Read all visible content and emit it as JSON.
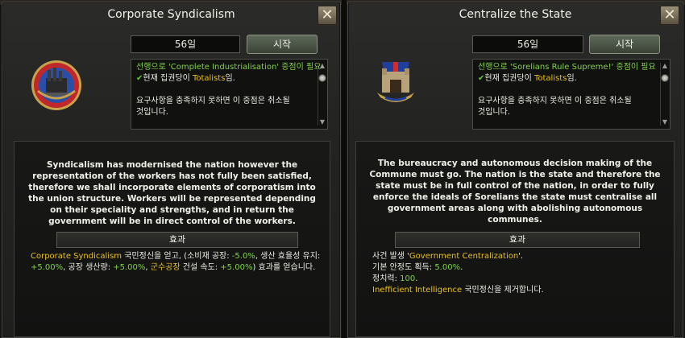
{
  "left": {
    "title": "Corporate Syndicalism",
    "days": "56일",
    "start": "시작",
    "emblem_icon": "factory-emblem-icon",
    "req": {
      "line1_pre": "선행으로 '",
      "line1_focus": "Complete Industrialisation",
      "line1_post": "' 중점이 필요",
      "line2_pre": "현재 집권당이 ",
      "line2_party": "Totalists",
      "line2_post": "임.",
      "line3": "요구사항을 충족하지 못하면 이 중점은 취소될",
      "line4": "것입니다."
    },
    "desc": "Syndicalism has modernised the nation however the representation of the workers has not fully been satisfied, therefore we shall incorporate elements of corporatism into the union structure. Workers will be represented depending on their speciality and strengths, and in return the government will be in direct control of the workers.",
    "effect_label": "효과",
    "effects": {
      "idea": "Corporate Syndicalism",
      "t1": " 국민정신을 얻고, (소비재 공장: ",
      "v1": "-5.0%",
      "t2": ", 생산 효율성 유지:",
      "v2": "+5.00%",
      "t3": ", 공장 생산량: ",
      "v3": "+5.00%",
      "t4": ", ",
      "mil": "군수공장",
      "t5": " 건설 속도: ",
      "v4": "+5.00%",
      "t6": ") 효과를 얻습니다."
    }
  },
  "right": {
    "title": "Centralize the State",
    "days": "56일",
    "start": "시작",
    "emblem_icon": "fortress-flag-emblem-icon",
    "req": {
      "line1_pre": "선행으로 '",
      "line1_focus": "Sorelians Rule Supreme!",
      "line1_post": "' 중점이 필요",
      "line2_pre": "현재 집권당이 ",
      "line2_party": "Totalists",
      "line2_post": "임.",
      "line3": "요구사항을 충족하지 못하면 이 중점은 취소될",
      "line4": "것입니다."
    },
    "desc": "The bureaucracy and autonomous decision making of the Commune must go. The nation is the state and therefore the state must be in full control of the nation, in order to fully enforce the ideals of Sorelians the state must centralise all government areas along with abolishing autonomous communes.",
    "effect_label": "효과",
    "effects": {
      "e1_pre": "사건 발생 '",
      "e1_event": "Government Centralization",
      "e1_post": "'.",
      "e2_pre": "기본 안정도 획득: ",
      "e2_val": "5.00%",
      "e2_post": ".",
      "e3_pre": "정치력: ",
      "e3_val": "100",
      "e3_post": ".",
      "e4_idea": "Inefficient Intelligence",
      "e4_post": " 국민정신을 제거합니다."
    }
  },
  "colors": {
    "highlight_green": "#7fd34a",
    "highlight_yellow": "#e6c021"
  }
}
